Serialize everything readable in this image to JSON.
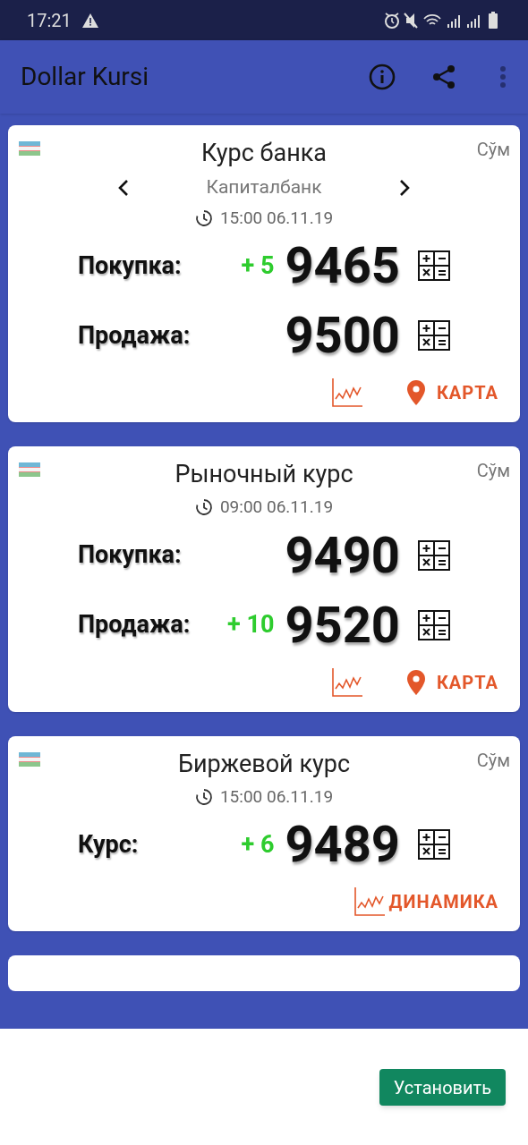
{
  "status_bar": {
    "time": "17:21"
  },
  "app_bar": {
    "title": "Dollar Kursi"
  },
  "cards": [
    {
      "title": "Курс банка",
      "currency": "Сўм",
      "bank": "Капиталбанк",
      "time": "15:00 06.11.19",
      "rows": [
        {
          "label": "Покупка:",
          "change": "+ 5",
          "value": "9465"
        },
        {
          "label": "Продажа:",
          "value": "9500"
        }
      ],
      "actions": [
        {
          "kind": "chart"
        },
        {
          "kind": "map",
          "label": "КАРТА"
        }
      ]
    },
    {
      "title": "Рыночный курс",
      "currency": "Сўм",
      "time": "09:00 06.11.19",
      "rows": [
        {
          "label": "Покупка:",
          "value": "9490"
        },
        {
          "label": "Продажа:",
          "change": "+ 10",
          "value": "9520"
        }
      ],
      "actions": [
        {
          "kind": "chart"
        },
        {
          "kind": "map",
          "label": "КАРТА"
        }
      ]
    },
    {
      "title": "Биржевой курс",
      "currency": "Сўм",
      "time": "15:00 06.11.19",
      "rows": [
        {
          "label": "Курс:",
          "change": "+ 6",
          "value": "9489"
        }
      ],
      "actions": [
        {
          "kind": "chart",
          "label": "ДИНАМИКА"
        }
      ]
    }
  ],
  "install_button": "Установить"
}
